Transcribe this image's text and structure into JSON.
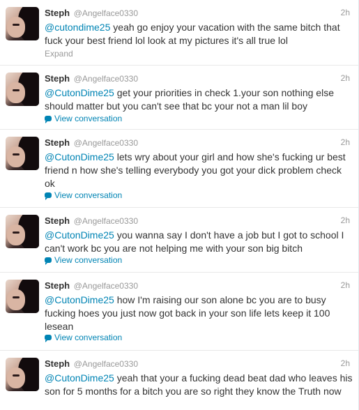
{
  "tweets": [
    {
      "name": "Steph",
      "handle": "@Angelface0330",
      "time": "2h",
      "mention": "@cutondime25",
      "body": " yeah go enjoy your vacation with the same bitch that fuck your best friend lol look at my pictures it's all true lol",
      "action": "Expand"
    },
    {
      "name": "Steph",
      "handle": "@Angelface0330",
      "time": "2h",
      "mention": "@CutonDime25",
      "body": " get your priorities in check 1.your son nothing else should matter but you can't see that bc your not a man lil boy",
      "action": "View conversation"
    },
    {
      "name": "Steph",
      "handle": "@Angelface0330",
      "time": "2h",
      "mention": "@CutonDime25",
      "body": " lets wry about your girl and how she's fucking ur best friend n how she's telling everybody you got your dick problem check ok",
      "action": "View conversation"
    },
    {
      "name": "Steph",
      "handle": "@Angelface0330",
      "time": "2h",
      "mention": "@CutonDime25",
      "body": " you wanna say I don't have a job but I got to school I can't work bc you are not helping me with your son big bitch",
      "action": "View conversation"
    },
    {
      "name": "Steph",
      "handle": "@Angelface0330",
      "time": "2h",
      "mention": "@CutonDime25",
      "body": " how I'm raising our son alone bc you are to busy fucking hoes you just now got back in your son life lets keep it 100 lesean",
      "action": "View conversation"
    },
    {
      "name": "Steph",
      "handle": "@Angelface0330",
      "time": "2h",
      "mention": "@CutonDime25",
      "body": " yeah that your a fucking dead beat dad who leaves his son for 5 months for a bitch you are so right they know the Truth now",
      "action": ""
    }
  ],
  "colors": {
    "link": "#0084b4",
    "muted": "#999999",
    "text": "#333333",
    "divider": "#e8e8e8"
  },
  "icons": {
    "conversation": "speech-bubble-icon"
  }
}
